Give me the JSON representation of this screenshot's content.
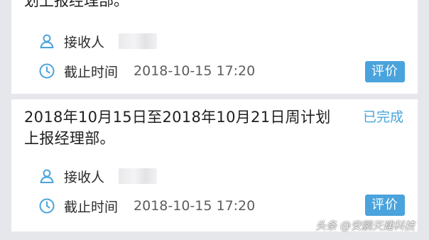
{
  "cards": [
    {
      "title_tail": "划上报经理部。",
      "receiver_label": "接收人",
      "deadline_label": "截止时间",
      "deadline_value": "2018-10-15 17:20",
      "action_label": "评价"
    },
    {
      "title": "2018年10月15日至2018年10月21日周计划上报经理部。",
      "status": "已完成",
      "receiver_label": "接收人",
      "deadline_label": "截止时间",
      "deadline_value": "2018-10-15 17:20",
      "action_label": "评价"
    }
  ],
  "watermark": "头条 @安鹏天建科技",
  "icons": {
    "person": "person-icon",
    "clock": "clock-icon"
  },
  "colors": {
    "accent": "#4aa3dc",
    "status": "#4aa6d8",
    "background": "#e6e7eb"
  }
}
